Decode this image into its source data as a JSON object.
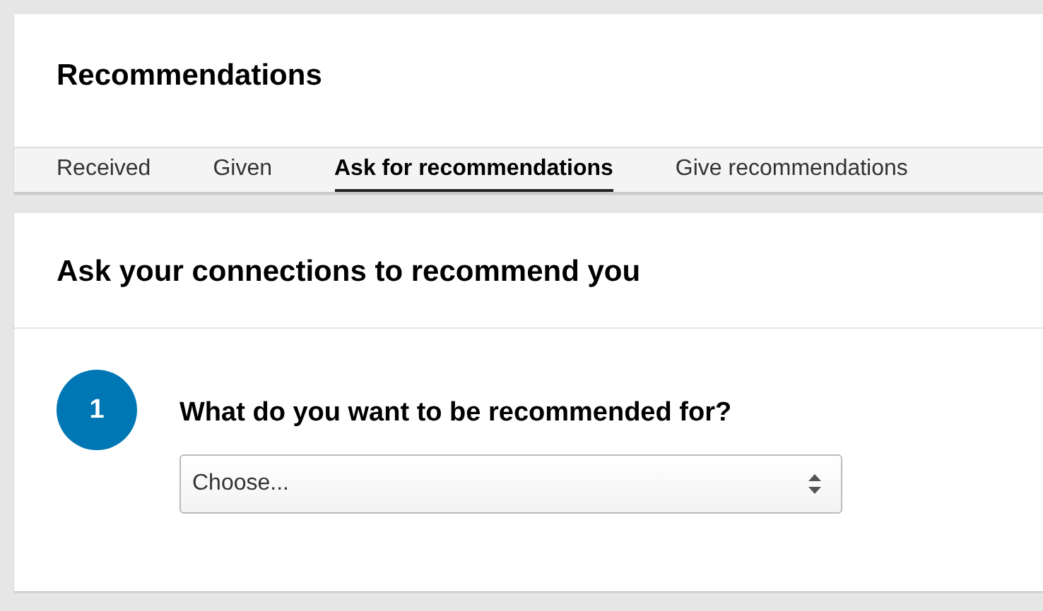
{
  "header": {
    "title": "Recommendations"
  },
  "tabs": [
    {
      "label": "Received",
      "selected": false
    },
    {
      "label": "Given",
      "selected": false
    },
    {
      "label": "Ask for recommendations",
      "selected": true
    },
    {
      "label": "Give recommendations",
      "selected": false
    }
  ],
  "panel": {
    "title": "Ask your connections to recommend you",
    "step": {
      "number": "1",
      "question": "What do you want to be recommended for?"
    },
    "select": {
      "placeholder": "Choose..."
    }
  }
}
